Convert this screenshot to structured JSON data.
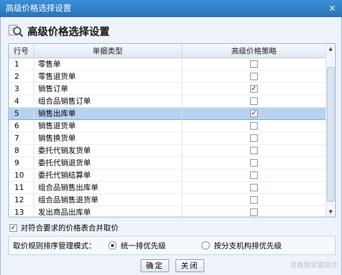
{
  "window": {
    "title": "高级价格选择设置",
    "close_glyph": "×"
  },
  "header": {
    "title": "高级价格选择设置",
    "icon": "search-settings-icon"
  },
  "grid": {
    "columns": [
      "行号",
      "单据类型",
      "高级价格策略"
    ],
    "rows": [
      {
        "num": "1",
        "type": "零售单",
        "checked": false
      },
      {
        "num": "2",
        "type": "零售退货单",
        "checked": false
      },
      {
        "num": "3",
        "type": "销售订单",
        "checked": true
      },
      {
        "num": "4",
        "type": "组合品销售订单",
        "checked": false
      },
      {
        "num": "5",
        "type": "销售出库单",
        "checked": true,
        "selected": true
      },
      {
        "num": "6",
        "type": "销售退货单",
        "checked": false
      },
      {
        "num": "7",
        "type": "销售换货单",
        "checked": false
      },
      {
        "num": "8",
        "type": "委托代销发货单",
        "checked": false
      },
      {
        "num": "9",
        "type": "委托代销退货单",
        "checked": false
      },
      {
        "num": "10",
        "type": "委托代销结算单",
        "checked": false
      },
      {
        "num": "11",
        "type": "组合品销售出库单",
        "checked": false
      },
      {
        "num": "12",
        "type": "组合品销售退货单",
        "checked": false
      },
      {
        "num": "13",
        "type": "发出商品出库单",
        "checked": false
      }
    ]
  },
  "options": {
    "merge_label": "对符合要求的价格表合并取价",
    "merge_checked": true
  },
  "mode": {
    "label": "取价规则排序管理模式：",
    "choices": [
      {
        "label": "统一排优先级",
        "selected": true
      },
      {
        "label": "按分支机构排优先级",
        "selected": false
      }
    ]
  },
  "buttons": {
    "ok": "确定",
    "close": "关闭"
  },
  "watermark": "双格管家婆软件",
  "colors": {
    "titlebar": "#2f7ec6",
    "selected_row": "#b8d3f2"
  }
}
